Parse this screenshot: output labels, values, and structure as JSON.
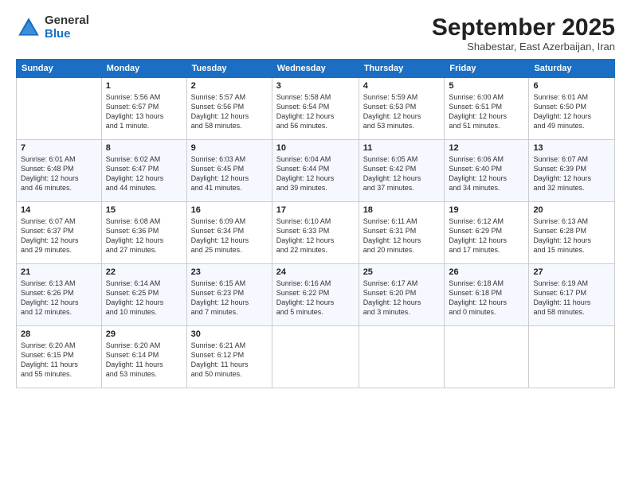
{
  "header": {
    "logo_general": "General",
    "logo_blue": "Blue",
    "month_title": "September 2025",
    "location": "Shabestar, East Azerbaijan, Iran"
  },
  "days_of_week": [
    "Sunday",
    "Monday",
    "Tuesday",
    "Wednesday",
    "Thursday",
    "Friday",
    "Saturday"
  ],
  "weeks": [
    [
      {
        "day": "",
        "info": ""
      },
      {
        "day": "1",
        "info": "Sunrise: 5:56 AM\nSunset: 6:57 PM\nDaylight: 13 hours\nand 1 minute."
      },
      {
        "day": "2",
        "info": "Sunrise: 5:57 AM\nSunset: 6:56 PM\nDaylight: 12 hours\nand 58 minutes."
      },
      {
        "day": "3",
        "info": "Sunrise: 5:58 AM\nSunset: 6:54 PM\nDaylight: 12 hours\nand 56 minutes."
      },
      {
        "day": "4",
        "info": "Sunrise: 5:59 AM\nSunset: 6:53 PM\nDaylight: 12 hours\nand 53 minutes."
      },
      {
        "day": "5",
        "info": "Sunrise: 6:00 AM\nSunset: 6:51 PM\nDaylight: 12 hours\nand 51 minutes."
      },
      {
        "day": "6",
        "info": "Sunrise: 6:01 AM\nSunset: 6:50 PM\nDaylight: 12 hours\nand 49 minutes."
      }
    ],
    [
      {
        "day": "7",
        "info": "Sunrise: 6:01 AM\nSunset: 6:48 PM\nDaylight: 12 hours\nand 46 minutes."
      },
      {
        "day": "8",
        "info": "Sunrise: 6:02 AM\nSunset: 6:47 PM\nDaylight: 12 hours\nand 44 minutes."
      },
      {
        "day": "9",
        "info": "Sunrise: 6:03 AM\nSunset: 6:45 PM\nDaylight: 12 hours\nand 41 minutes."
      },
      {
        "day": "10",
        "info": "Sunrise: 6:04 AM\nSunset: 6:44 PM\nDaylight: 12 hours\nand 39 minutes."
      },
      {
        "day": "11",
        "info": "Sunrise: 6:05 AM\nSunset: 6:42 PM\nDaylight: 12 hours\nand 37 minutes."
      },
      {
        "day": "12",
        "info": "Sunrise: 6:06 AM\nSunset: 6:40 PM\nDaylight: 12 hours\nand 34 minutes."
      },
      {
        "day": "13",
        "info": "Sunrise: 6:07 AM\nSunset: 6:39 PM\nDaylight: 12 hours\nand 32 minutes."
      }
    ],
    [
      {
        "day": "14",
        "info": "Sunrise: 6:07 AM\nSunset: 6:37 PM\nDaylight: 12 hours\nand 29 minutes."
      },
      {
        "day": "15",
        "info": "Sunrise: 6:08 AM\nSunset: 6:36 PM\nDaylight: 12 hours\nand 27 minutes."
      },
      {
        "day": "16",
        "info": "Sunrise: 6:09 AM\nSunset: 6:34 PM\nDaylight: 12 hours\nand 25 minutes."
      },
      {
        "day": "17",
        "info": "Sunrise: 6:10 AM\nSunset: 6:33 PM\nDaylight: 12 hours\nand 22 minutes."
      },
      {
        "day": "18",
        "info": "Sunrise: 6:11 AM\nSunset: 6:31 PM\nDaylight: 12 hours\nand 20 minutes."
      },
      {
        "day": "19",
        "info": "Sunrise: 6:12 AM\nSunset: 6:29 PM\nDaylight: 12 hours\nand 17 minutes."
      },
      {
        "day": "20",
        "info": "Sunrise: 6:13 AM\nSunset: 6:28 PM\nDaylight: 12 hours\nand 15 minutes."
      }
    ],
    [
      {
        "day": "21",
        "info": "Sunrise: 6:13 AM\nSunset: 6:26 PM\nDaylight: 12 hours\nand 12 minutes."
      },
      {
        "day": "22",
        "info": "Sunrise: 6:14 AM\nSunset: 6:25 PM\nDaylight: 12 hours\nand 10 minutes."
      },
      {
        "day": "23",
        "info": "Sunrise: 6:15 AM\nSunset: 6:23 PM\nDaylight: 12 hours\nand 7 minutes."
      },
      {
        "day": "24",
        "info": "Sunrise: 6:16 AM\nSunset: 6:22 PM\nDaylight: 12 hours\nand 5 minutes."
      },
      {
        "day": "25",
        "info": "Sunrise: 6:17 AM\nSunset: 6:20 PM\nDaylight: 12 hours\nand 3 minutes."
      },
      {
        "day": "26",
        "info": "Sunrise: 6:18 AM\nSunset: 6:18 PM\nDaylight: 12 hours\nand 0 minutes."
      },
      {
        "day": "27",
        "info": "Sunrise: 6:19 AM\nSunset: 6:17 PM\nDaylight: 11 hours\nand 58 minutes."
      }
    ],
    [
      {
        "day": "28",
        "info": "Sunrise: 6:20 AM\nSunset: 6:15 PM\nDaylight: 11 hours\nand 55 minutes."
      },
      {
        "day": "29",
        "info": "Sunrise: 6:20 AM\nSunset: 6:14 PM\nDaylight: 11 hours\nand 53 minutes."
      },
      {
        "day": "30",
        "info": "Sunrise: 6:21 AM\nSunset: 6:12 PM\nDaylight: 11 hours\nand 50 minutes."
      },
      {
        "day": "",
        "info": ""
      },
      {
        "day": "",
        "info": ""
      },
      {
        "day": "",
        "info": ""
      },
      {
        "day": "",
        "info": ""
      }
    ]
  ]
}
